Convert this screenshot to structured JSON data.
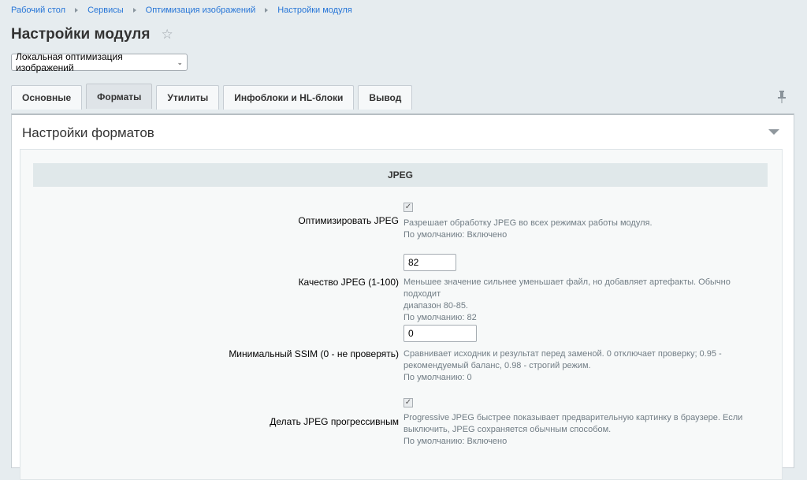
{
  "breadcrumb": [
    "Рабочий стол",
    "Сервисы",
    "Оптимизация изображений",
    "Настройки модуля"
  ],
  "page": {
    "title": "Настройки модуля"
  },
  "module_select": {
    "value": "Локальная оптимизация изображений"
  },
  "tabs": [
    {
      "label": "Основные",
      "active": false
    },
    {
      "label": "Форматы",
      "active": true
    },
    {
      "label": "Утилиты",
      "active": false
    },
    {
      "label": "Инфоблоки и HL-блоки",
      "active": false
    },
    {
      "label": "Вывод",
      "active": false
    }
  ],
  "panel": {
    "title": "Настройки форматов"
  },
  "section": {
    "title": "JPEG"
  },
  "fields": {
    "optimize": {
      "label": "Оптимизировать JPEG",
      "checked": true,
      "desc": "Разрешает обработку JPEG во всех режимах работы модуля.",
      "default": "По умолчанию: Включено"
    },
    "quality": {
      "label": "Качество JPEG (1-100)",
      "value": "82",
      "desc_line1": "Меньшее значение сильнее уменьшает файл, но добавляет артефакты. Обычно подходит",
      "desc_line2": "диапазон 80-85.",
      "default": "По умолчанию: 82"
    },
    "ssim": {
      "label": "Минимальный SSIM (0 - не проверять)",
      "value": "0",
      "desc_line1": "Сравнивает исходник и результат перед заменой. 0 отключает проверку; 0.95 -",
      "desc_line2": "рекомендуемый баланс, 0.98 - строгий режим.",
      "default": "По умолчанию: 0"
    },
    "progressive": {
      "label": "Делать JPEG прогрессивным",
      "checked": true,
      "desc_line1": "Progressive JPEG быстрее показывает предварительную картинку в браузере. Если",
      "desc_line2": "выключить, JPEG сохраняется обычным способом.",
      "default": "По умолчанию: Включено"
    }
  }
}
